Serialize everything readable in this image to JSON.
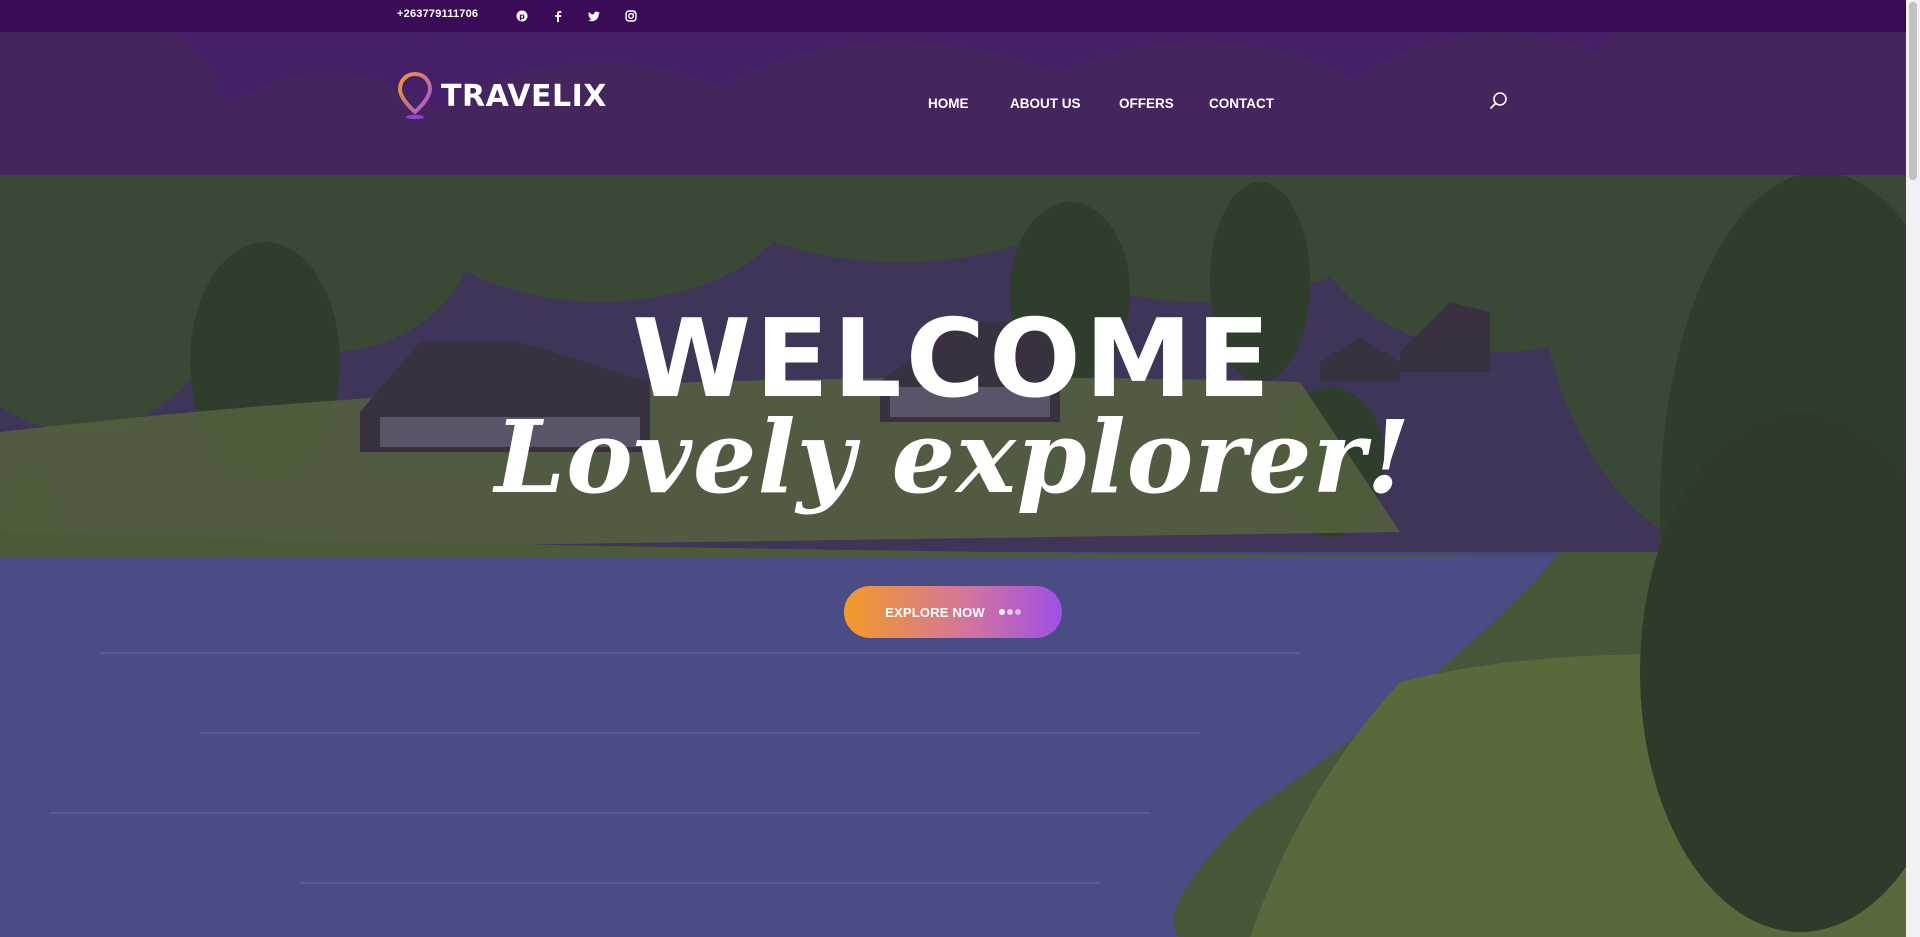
{
  "topbar": {
    "phone": "+263779111706",
    "social": [
      {
        "icon": "pinterest-icon"
      },
      {
        "icon": "facebook-icon"
      },
      {
        "icon": "twitter-icon"
      },
      {
        "icon": "instagram-icon"
      }
    ]
  },
  "header": {
    "logo_text": "TRAVELIX",
    "nav": [
      {
        "label": "HOME"
      },
      {
        "label": "ABOUT US"
      },
      {
        "label": "OFFERS"
      },
      {
        "label": "CONTACT"
      }
    ],
    "search_icon": "search-icon"
  },
  "hero": {
    "title": "WELCOME",
    "tagline": "Lovely explorer!",
    "cta_label": "EXPLORE NOW"
  },
  "colors": {
    "topbar": "#3a0c58",
    "header_overlay": "#48186e",
    "cta_start": "#f39a28",
    "cta_end": "#a04fe6"
  }
}
